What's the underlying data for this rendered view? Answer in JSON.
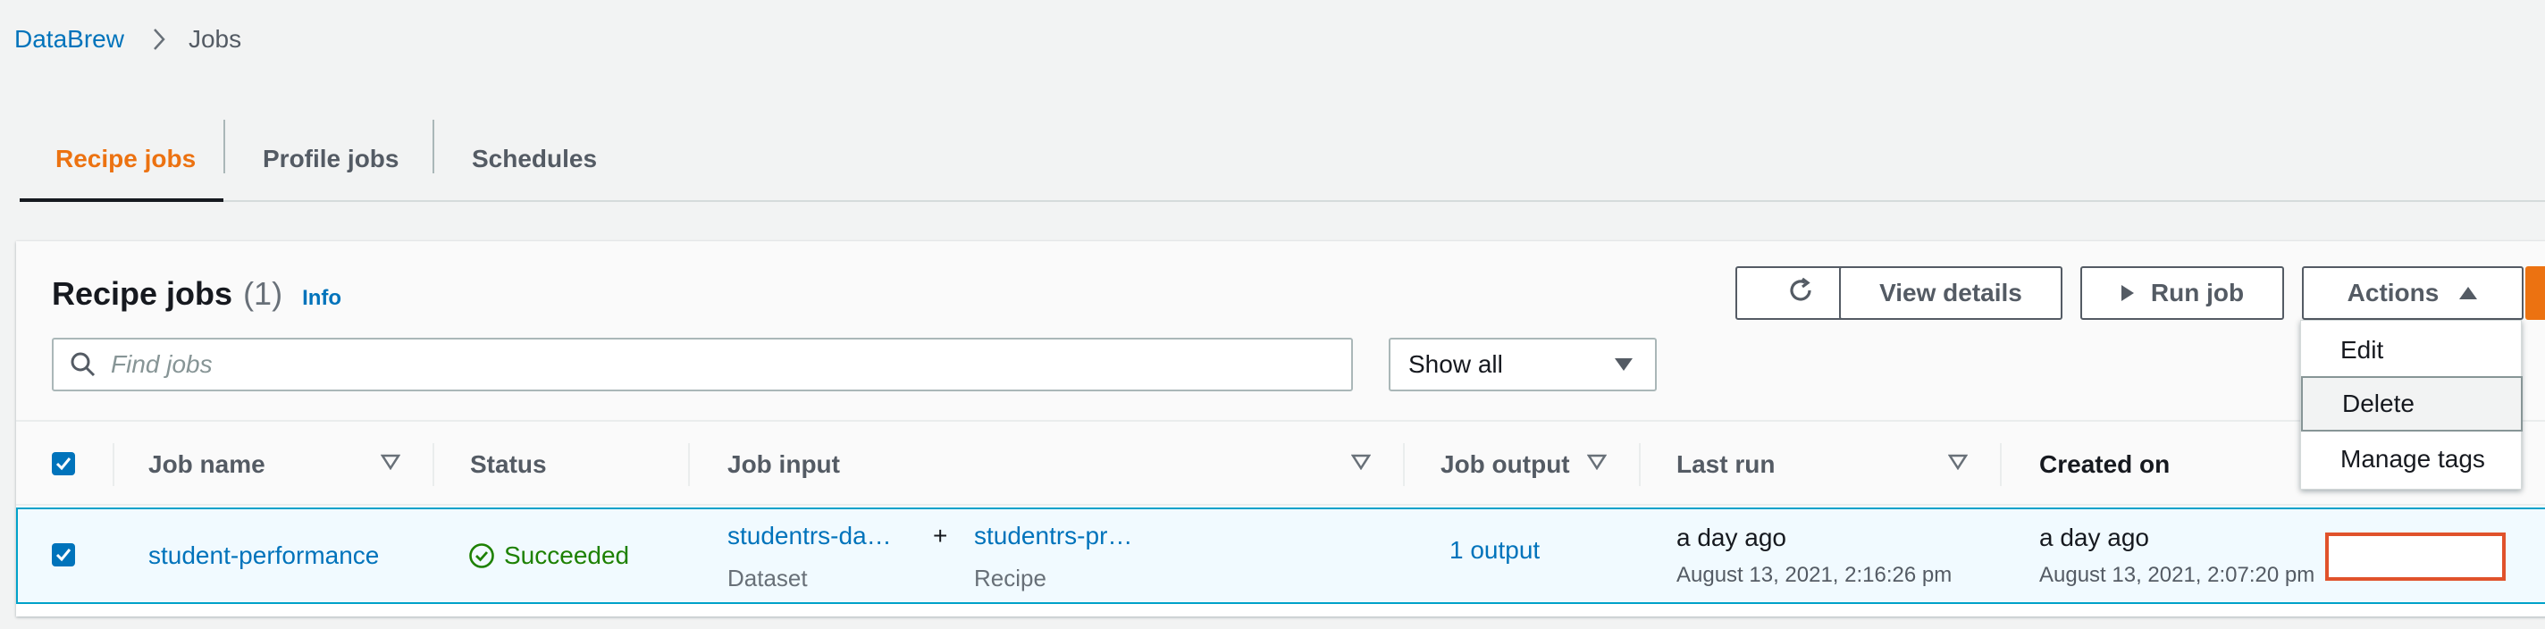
{
  "breadcrumb": {
    "root": "DataBrew",
    "current": "Jobs"
  },
  "tabs": [
    {
      "label": "Recipe jobs",
      "active": true
    },
    {
      "label": "Profile jobs",
      "active": false
    },
    {
      "label": "Schedules",
      "active": false
    }
  ],
  "panel": {
    "title": "Recipe jobs",
    "count": "(1)",
    "info": "Info"
  },
  "toolbar": {
    "view_details": "View details",
    "run_job": "Run job",
    "actions": "Actions"
  },
  "search": {
    "placeholder": "Find jobs"
  },
  "filter": {
    "selected": "Show all"
  },
  "table": {
    "columns": [
      "Job name",
      "Status",
      "Job input",
      "Job output",
      "Last run",
      "Created on"
    ],
    "rows": [
      {
        "job_name": "student-performance",
        "status": "Succeeded",
        "dataset_name": "studentrs-da…",
        "dataset_type": "Dataset",
        "plus": "+",
        "recipe_name": "studentrs-pr…",
        "recipe_type": "Recipe",
        "output": "1 output",
        "last_run_rel": "a day ago",
        "last_run_abs": "August 13, 2021, 2:16:26 pm",
        "created_rel": "a day ago",
        "created_abs": "August 13, 2021, 2:07:20 pm"
      }
    ]
  },
  "actions_menu": {
    "items": [
      "Edit",
      "Delete",
      "Manage tags"
    ],
    "highlighted": "Delete"
  },
  "colors": {
    "accent": "#ec7211",
    "link": "#0073bb",
    "success": "#1d8102",
    "highlight_border": "#e0522b"
  }
}
